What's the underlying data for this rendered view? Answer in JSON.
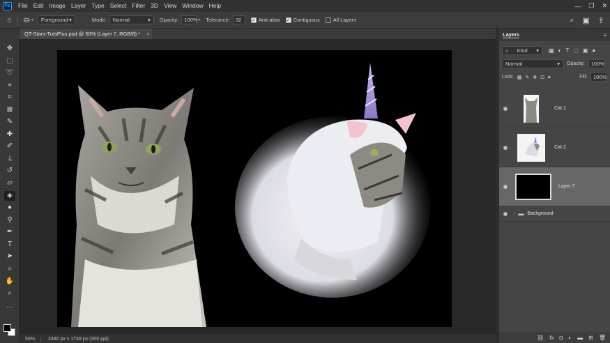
{
  "app": {
    "logo": "Ps"
  },
  "menu": [
    "File",
    "Edit",
    "Image",
    "Layer",
    "Type",
    "Select",
    "Filter",
    "3D",
    "View",
    "Window",
    "Help"
  ],
  "options": {
    "fill_source": "Foreground",
    "mode_label": "Mode:",
    "mode_value": "Normal",
    "opacity_label": "Opacity:",
    "opacity_value": "100%",
    "tolerance_label": "Tolerance:",
    "tolerance_value": "32",
    "anti_alias_label": "Anti-alias",
    "anti_alias_checked": true,
    "contiguous_label": "Contiguous",
    "contiguous_checked": true,
    "all_layers_label": "All Layers",
    "all_layers_checked": false
  },
  "document": {
    "tab_title": "QT-Stars-TutsPlus.psd @ 50% (Layer 7, RGB/8) *",
    "close_glyph": "×"
  },
  "status": {
    "zoom": "50%",
    "doc_info": "2480 px x 1748 px (300 ppi)"
  },
  "layers_panel": {
    "title": "Layers",
    "filter_kind": "Kind",
    "blend_mode": "Normal",
    "opacity_label": "Opacity:",
    "opacity_value": "100%",
    "lock_label": "Lock:",
    "fill_label": "Fill:",
    "fill_value": "100%",
    "layers": [
      {
        "name": "Cat 1",
        "selected": false
      },
      {
        "name": "Cat 2",
        "selected": false
      },
      {
        "name": "Layer 7",
        "selected": true
      },
      {
        "name": "Background",
        "selected": false
      }
    ]
  },
  "colors": {
    "foreground": "#000000",
    "background": "#ffffff",
    "accent": "#31a8ff"
  }
}
